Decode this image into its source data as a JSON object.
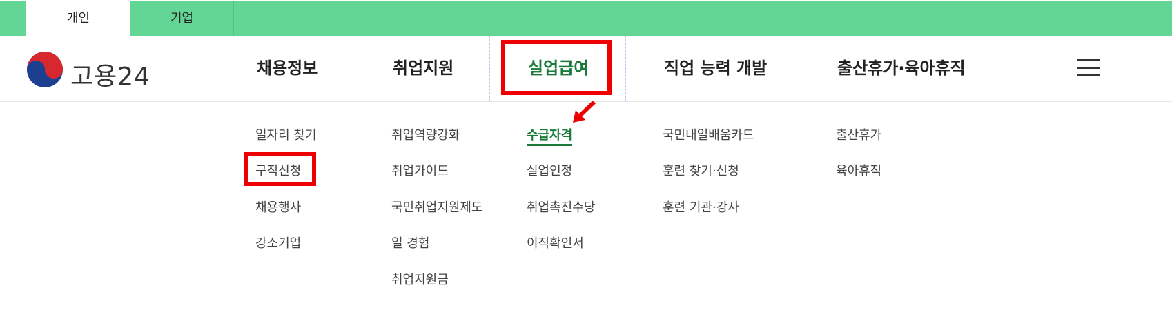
{
  "tabs": [
    {
      "label": "개인",
      "active": true
    },
    {
      "label": "기업",
      "active": false
    }
  ],
  "logo": {
    "text": "고용24"
  },
  "gnb": [
    {
      "label": "채용정보"
    },
    {
      "label": "취업지원"
    },
    {
      "label": "실업급여",
      "active": true
    },
    {
      "label": "직업 능력 개발"
    },
    {
      "label": "출산휴가·육아휴직"
    }
  ],
  "menu_icon": "hamburger-menu-icon",
  "submenu": {
    "col1": [
      "일자리 찾기",
      "구직신청",
      "채용행사",
      "강소기업"
    ],
    "col2": [
      "취업역량강화",
      "취업가이드",
      "국민취업지원제도",
      "일 경험",
      "취업지원금"
    ],
    "col3": [
      "수급자격",
      "실업인정",
      "취업촉진수당",
      "이직확인서"
    ],
    "col4": [
      "국민내일배움카드",
      "훈련 찾기·신청",
      "훈련 기관·강사"
    ],
    "col5": [
      "출산휴가",
      "육아휴직"
    ]
  },
  "colors": {
    "topbar": "#63d594",
    "active_green": "#1a7a39",
    "highlight_red": "#ee0000"
  }
}
